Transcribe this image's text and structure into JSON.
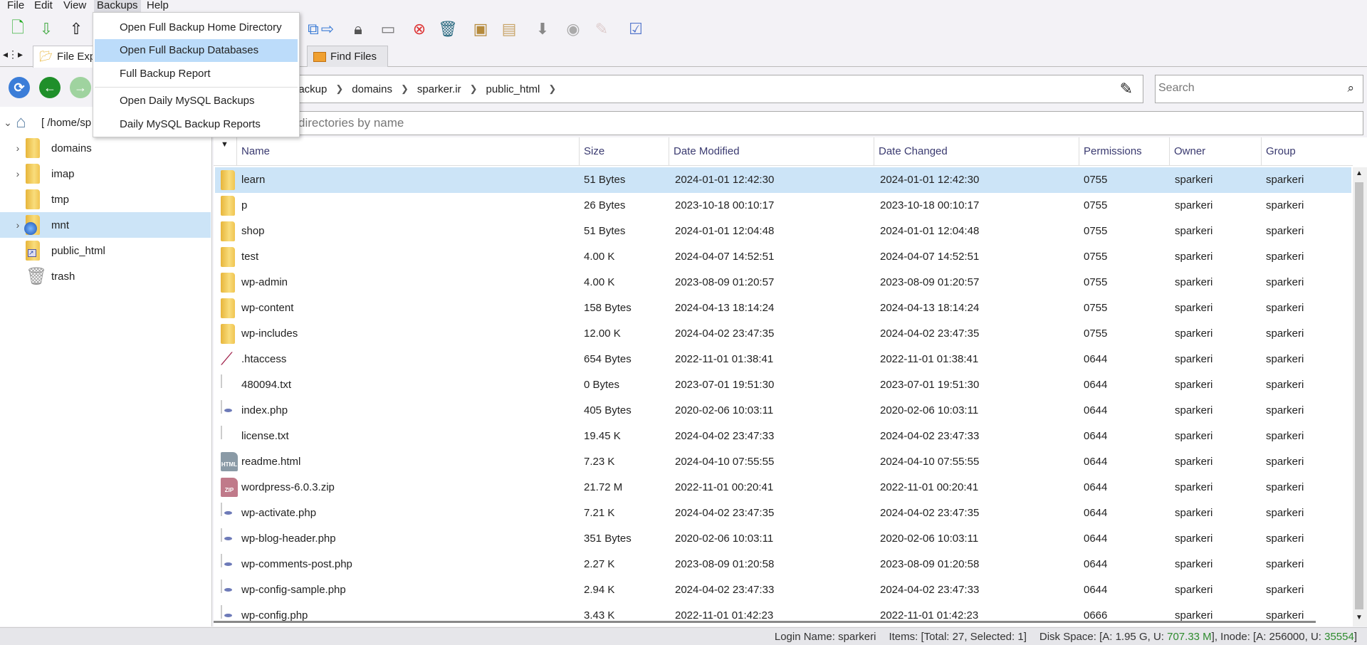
{
  "menubar": {
    "items": [
      "File",
      "Edit",
      "View",
      "Backups",
      "Help"
    ],
    "active": "Backups"
  },
  "toolbar": {
    "icons": [
      "new-file-icon",
      "download-icon",
      "upload-icon",
      "copy-icon",
      "move-icon",
      "permissions-lock-icon",
      "rename-icon",
      "delete-file-icon",
      "trash-icon",
      "extract-icon",
      "compress-icon",
      "download-arrow-icon",
      "view-icon",
      "edit-icon",
      "select-all-icon"
    ]
  },
  "tabs": [
    {
      "label": "File Exp",
      "active": true
    },
    {
      "label": "Find Files",
      "active": false
    }
  ],
  "address": {
    "crumbs": [
      "backup",
      "domains",
      "sparker.ir",
      "public_html"
    ]
  },
  "search": {
    "placeholder": "Search"
  },
  "filter": {
    "placeholder": "directories by name"
  },
  "tree": {
    "root": "[ /home/sp",
    "items": [
      {
        "label": "domains",
        "icon": "folder",
        "expandable": true
      },
      {
        "label": "imap",
        "icon": "folder",
        "expandable": true
      },
      {
        "label": "tmp",
        "icon": "folder",
        "expandable": false
      },
      {
        "label": "mnt",
        "icon": "globe-folder",
        "expandable": true,
        "selected": true
      },
      {
        "label": "public_html",
        "icon": "link-folder",
        "expandable": false
      },
      {
        "label": "trash",
        "icon": "trash",
        "expandable": false
      }
    ]
  },
  "columns": [
    "Name",
    "Size",
    "Date Modified",
    "Date Changed",
    "Permissions",
    "Owner",
    "Group"
  ],
  "files": [
    {
      "name": "learn",
      "type": "folder",
      "size": "51 Bytes",
      "modified": "2024-01-01 12:42:30",
      "changed": "2024-01-01 12:42:30",
      "perm": "0755",
      "owner": "sparkeri",
      "group": "sparkeri",
      "selected": true
    },
    {
      "name": "p",
      "type": "folder",
      "size": "26 Bytes",
      "modified": "2023-10-18 00:10:17",
      "changed": "2023-10-18 00:10:17",
      "perm": "0755",
      "owner": "sparkeri",
      "group": "sparkeri"
    },
    {
      "name": "shop",
      "type": "folder",
      "size": "51 Bytes",
      "modified": "2024-01-01 12:04:48",
      "changed": "2024-01-01 12:04:48",
      "perm": "0755",
      "owner": "sparkeri",
      "group": "sparkeri"
    },
    {
      "name": "test",
      "type": "folder",
      "size": "4.00 K",
      "modified": "2024-04-07 14:52:51",
      "changed": "2024-04-07 14:52:51",
      "perm": "0755",
      "owner": "sparkeri",
      "group": "sparkeri"
    },
    {
      "name": "wp-admin",
      "type": "folder",
      "size": "4.00 K",
      "modified": "2023-08-09 01:20:57",
      "changed": "2023-08-09 01:20:57",
      "perm": "0755",
      "owner": "sparkeri",
      "group": "sparkeri"
    },
    {
      "name": "wp-content",
      "type": "folder",
      "size": "158 Bytes",
      "modified": "2024-04-13 18:14:24",
      "changed": "2024-04-13 18:14:24",
      "perm": "0755",
      "owner": "sparkeri",
      "group": "sparkeri"
    },
    {
      "name": "wp-includes",
      "type": "folder",
      "size": "12.00 K",
      "modified": "2024-04-02 23:47:35",
      "changed": "2024-04-02 23:47:35",
      "perm": "0755",
      "owner": "sparkeri",
      "group": "sparkeri"
    },
    {
      "name": ".htaccess",
      "type": "htaccess",
      "size": "654 Bytes",
      "modified": "2022-11-01 01:38:41",
      "changed": "2022-11-01 01:38:41",
      "perm": "0644",
      "owner": "sparkeri",
      "group": "sparkeri"
    },
    {
      "name": "480094.txt",
      "type": "txt",
      "size": "0 Bytes",
      "modified": "2023-07-01 19:51:30",
      "changed": "2023-07-01 19:51:30",
      "perm": "0644",
      "owner": "sparkeri",
      "group": "sparkeri"
    },
    {
      "name": "index.php",
      "type": "php",
      "size": "405 Bytes",
      "modified": "2020-02-06 10:03:11",
      "changed": "2020-02-06 10:03:11",
      "perm": "0644",
      "owner": "sparkeri",
      "group": "sparkeri"
    },
    {
      "name": "license.txt",
      "type": "txt",
      "size": "19.45 K",
      "modified": "2024-04-02 23:47:33",
      "changed": "2024-04-02 23:47:33",
      "perm": "0644",
      "owner": "sparkeri",
      "group": "sparkeri"
    },
    {
      "name": "readme.html",
      "type": "html",
      "size": "7.23 K",
      "modified": "2024-04-10 07:55:55",
      "changed": "2024-04-10 07:55:55",
      "perm": "0644",
      "owner": "sparkeri",
      "group": "sparkeri"
    },
    {
      "name": "wordpress-6.0.3.zip",
      "type": "zip",
      "size": "21.72 M",
      "modified": "2022-11-01 00:20:41",
      "changed": "2022-11-01 00:20:41",
      "perm": "0644",
      "owner": "sparkeri",
      "group": "sparkeri"
    },
    {
      "name": "wp-activate.php",
      "type": "php",
      "size": "7.21 K",
      "modified": "2024-04-02 23:47:35",
      "changed": "2024-04-02 23:47:35",
      "perm": "0644",
      "owner": "sparkeri",
      "group": "sparkeri"
    },
    {
      "name": "wp-blog-header.php",
      "type": "php",
      "size": "351 Bytes",
      "modified": "2020-02-06 10:03:11",
      "changed": "2020-02-06 10:03:11",
      "perm": "0644",
      "owner": "sparkeri",
      "group": "sparkeri"
    },
    {
      "name": "wp-comments-post.php",
      "type": "php",
      "size": "2.27 K",
      "modified": "2023-08-09 01:20:58",
      "changed": "2023-08-09 01:20:58",
      "perm": "0644",
      "owner": "sparkeri",
      "group": "sparkeri"
    },
    {
      "name": "wp-config-sample.php",
      "type": "php",
      "size": "2.94 K",
      "modified": "2024-04-02 23:47:33",
      "changed": "2024-04-02 23:47:33",
      "perm": "0644",
      "owner": "sparkeri",
      "group": "sparkeri"
    },
    {
      "name": "wp-config.php",
      "type": "php",
      "size": "3.43 K",
      "modified": "2022-11-01 01:42:23",
      "changed": "2022-11-01 01:42:23",
      "perm": "0666",
      "owner": "sparkeri",
      "group": "sparkeri"
    }
  ],
  "type_labels": {
    "html": "HTML",
    "zip": "ZIP"
  },
  "status": {
    "login": "Login Name: sparkeri",
    "items": "Items: [Total: 27, Selected: 1]",
    "disk_prefix": "Disk Space: [A: 1.95 G, U: ",
    "disk_used": "707.33 M",
    "inode_prefix": "], Inode: [A: 256000, U: ",
    "inode_used": "35554",
    "suffix": "]"
  },
  "backups_menu": {
    "items": [
      "Open Full Backup Home Directory",
      "Open Full Backup Databases",
      "Full Backup Report",
      "Open Daily MySQL Backups",
      "Daily MySQL Backup Reports"
    ],
    "hovered": 1
  },
  "colors": {
    "selection": "#cce4f7",
    "menu_hover": "#bcdcfa",
    "header_text": "#3a3a70",
    "used_green": "#2e8b2e"
  }
}
